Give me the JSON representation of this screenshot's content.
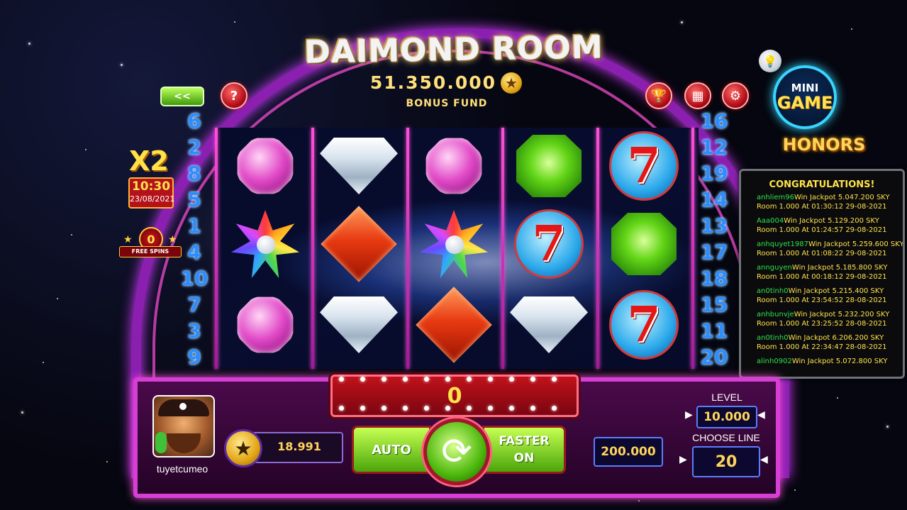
{
  "game": {
    "title": "DAIMOND ROOM",
    "bonus_fund_value": "51.350.000",
    "bonus_fund_label": "BONUS FUND"
  },
  "top_buttons": {
    "back_label": "<<",
    "help_label": "?"
  },
  "mini_game": {
    "line1": "MINI",
    "line2": "GAME"
  },
  "paylines_left": [
    "6",
    "2",
    "8",
    "5",
    "1",
    "4",
    "10",
    "7",
    "3",
    "9"
  ],
  "paylines_right": [
    "16",
    "12",
    "19",
    "14",
    "13",
    "17",
    "18",
    "15",
    "11",
    "20"
  ],
  "multiplier": {
    "label": "X2",
    "time": "10:30",
    "date": "23/08/2021"
  },
  "free_spins": {
    "count": "0",
    "label": "FREE SPINS"
  },
  "reels": [
    [
      "pink-gem",
      "star-gem",
      "pink-gem"
    ],
    [
      "white-gem",
      "red-gem",
      "white-gem"
    ],
    [
      "pink-gem",
      "star-gem",
      "red-gem"
    ],
    [
      "green-gem",
      "seven",
      "white-gem"
    ],
    [
      "seven",
      "green-gem",
      "seven"
    ]
  ],
  "honors": {
    "title": "HONORS",
    "heading": "CONGRATULATIONS!",
    "entries": [
      {
        "user": "anhliem96",
        "line1": "Win Jackpot 5.047.200 SKY",
        "line2": "Room 1.000 At 01:30:12 29-08-2021"
      },
      {
        "user": "Aaa004",
        "line1": "Win Jackpot 5.129.200 SKY",
        "line2": "Room 1.000 At 01:24:57 29-08-2021"
      },
      {
        "user": "anhquyet1987",
        "line1": "Win Jackpot 5.259.600 SKY",
        "line2": "Room 1.000 At 01:08:22 29-08-2021"
      },
      {
        "user": "annguyen",
        "line1": "Win Jackpot 5.185.800 SKY",
        "line2": "Room 1.000 At 00:18:12 29-08-2021"
      },
      {
        "user": "an0tinh0",
        "line1": "Win Jackpot 5.215.400 SKY",
        "line2": "Room 1.000 At 23:54:52 28-08-2021"
      },
      {
        "user": "anhbunvje",
        "line1": "Win Jackpot 5.232.200 SKY",
        "line2": "Room 1.000 At 23:25:52 28-08-2021"
      },
      {
        "user": "an0tinh0",
        "line1": "Win Jackpot 6.206.200 SKY",
        "line2": "Room 1.000 At 22:34:47 28-08-2021"
      },
      {
        "user": "alinh0902",
        "line1": "Win Jackpot 5.072.800 SKY",
        "line2": ""
      }
    ]
  },
  "win_display": "0",
  "player": {
    "username": "tuyetcumeo",
    "balance": "18.991"
  },
  "controls": {
    "auto_label": "AUTO",
    "faster_line1": "FASTER",
    "faster_line2": "ON",
    "total_bet": "200.000",
    "level_label": "LEVEL",
    "level_value": "10.000",
    "line_label": "CHOOSE LINE",
    "line_value": "20"
  }
}
